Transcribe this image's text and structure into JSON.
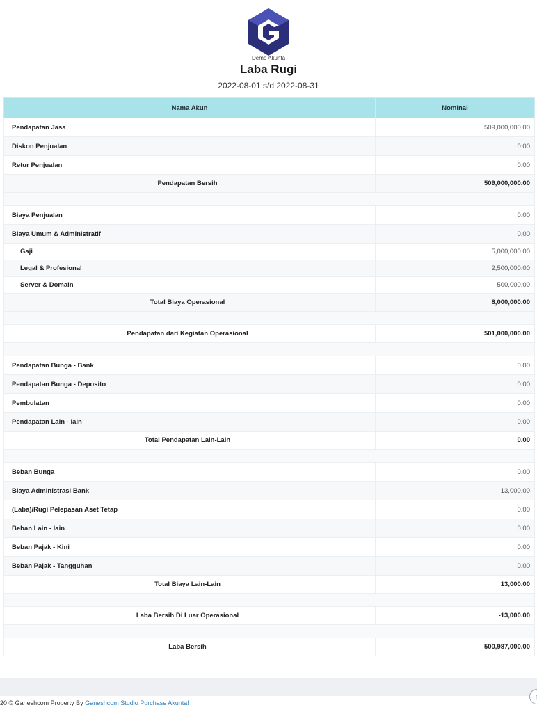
{
  "header": {
    "logo_icon": "akunta-g-logo",
    "company": "Demo Akunta",
    "title": "Laba Rugi",
    "period": "2022-08-01 s/d 2022-08-31"
  },
  "table": {
    "headers": [
      "Nama Akun",
      "Nominal"
    ],
    "rows": [
      {
        "type": "account",
        "name": "Pendapatan Jasa",
        "value": "509,000,000.00"
      },
      {
        "type": "account",
        "name": "Diskon Penjualan",
        "value": "0.00"
      },
      {
        "type": "account",
        "name": "Retur Penjualan",
        "value": "0.00"
      },
      {
        "type": "total",
        "name": "Pendapatan Bersih",
        "value": "509,000,000.00"
      },
      {
        "type": "spacer"
      },
      {
        "type": "account",
        "name": "Biaya Penjualan",
        "value": "0.00"
      },
      {
        "type": "account",
        "name": "Biaya Umum & Administratif",
        "value": "0.00"
      },
      {
        "type": "sub",
        "name": "Gaji",
        "value": "5,000,000.00"
      },
      {
        "type": "sub",
        "name": "Legal & Profesional",
        "value": "2,500,000.00"
      },
      {
        "type": "sub",
        "name": "Server & Domain",
        "value": "500,000.00"
      },
      {
        "type": "total",
        "name": "Total Biaya Operasional",
        "value": "8,000,000.00"
      },
      {
        "type": "spacer"
      },
      {
        "type": "total",
        "name": "Pendapatan dari Kegiatan Operasional",
        "value": "501,000,000.00"
      },
      {
        "type": "spacer"
      },
      {
        "type": "account",
        "name": "Pendapatan Bunga - Bank",
        "value": "0.00"
      },
      {
        "type": "account",
        "name": "Pendapatan Bunga - Deposito",
        "value": "0.00"
      },
      {
        "type": "account",
        "name": "Pembulatan",
        "value": "0.00"
      },
      {
        "type": "account",
        "name": "Pendapatan Lain - lain",
        "value": "0.00"
      },
      {
        "type": "total",
        "name": "Total Pendapatan Lain-Lain",
        "value": "0.00"
      },
      {
        "type": "spacer"
      },
      {
        "type": "account",
        "name": "Beban Bunga",
        "value": "0.00"
      },
      {
        "type": "account",
        "name": "Biaya Administrasi Bank",
        "value": "13,000.00"
      },
      {
        "type": "account",
        "name": "(Laba)/Rugi Pelepasan Aset Tetap",
        "value": "0.00"
      },
      {
        "type": "account",
        "name": "Beban Lain - lain",
        "value": "0.00"
      },
      {
        "type": "account",
        "name": "Beban Pajak - Kini",
        "value": "0.00"
      },
      {
        "type": "account",
        "name": "Beban Pajak - Tangguhan",
        "value": "0.00"
      },
      {
        "type": "total",
        "name": "Total Biaya Lain-Lain",
        "value": "13,000.00"
      },
      {
        "type": "spacer"
      },
      {
        "type": "total",
        "name": "Laba Bersih Di Luar Operasional",
        "value": "-13,000.00"
      },
      {
        "type": "spacer"
      },
      {
        "type": "total",
        "name": "Laba Bersih",
        "value": "500,987,000.00"
      }
    ]
  },
  "footer": {
    "prefix": "20 © Ganeshcom Property By ",
    "link": "Ganeshcom Studio Purchase Akunta!",
    "scroll_top_icon": "arrow-up-circle-icon",
    "scroll_top_glyph": "↑"
  },
  "colors": {
    "header_bg": "#a8e3ea",
    "logo_dark": "#2b2f7a",
    "logo_light": "#4b52b5",
    "link": "#2a7ab8"
  }
}
